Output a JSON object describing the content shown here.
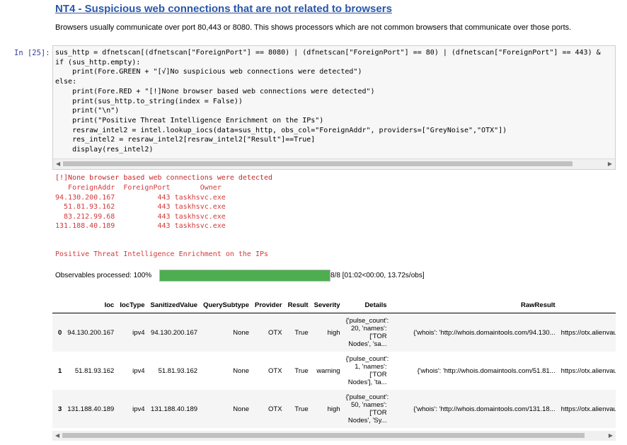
{
  "markdown": {
    "title": "NT4 - Suspicious web connections that are not related to browsers",
    "description": "Browsers usually communicate over port 80,443 or 8080. This shows processors which are not common browsers that communicate over those ports."
  },
  "cell": {
    "prompt": "In [25]:",
    "code": "sus_http = dfnetscan[(dfnetscan[\"ForeignPort\"] == 8080) | (dfnetscan[\"ForeignPort\"] == 80) | (dfnetscan[\"ForeignPort\"] == 443) &\nif (sus_http.empty):\n    print(Fore.GREEN + \"[√]No suspicious web connections were detected\")\nelse:\n    print(Fore.RED + \"[!]None browser based web connections were detected\")\n    print(sus_http.to_string(index = False))\n    print(\"\\n\")\n    print(\"Positive Threat Intelligence Enrichment on the IPs\")\n    resraw_intel2 = intel.lookup_iocs(data=sus_http, obs_col=\"ForeignAddr\", providers=[\"GreyNoise\",\"OTX\"])\n    res_intel2 = resraw_intel2[resraw_intel2[\"Result\"]==True]\n    display(res_intel2)"
  },
  "output": {
    "warning": "[!]None browser based web connections were detected",
    "text_table": "   ForeignAddr  ForeignPort       Owner\n94.130.200.167          443 taskhsvc.exe\n  51.81.93.162          443 taskhsvc.exe\n  83.212.99.68          443 taskhsvc.exe\n131.188.40.189          443 taskhsvc.exe",
    "enrichment_heading": "Positive Threat Intelligence Enrichment on the IPs",
    "progress_label": "Observables processed: 100%",
    "progress_fraction": 1.0,
    "progress_stat": "8/8 [01:02<00:00, 13.72s/obs]"
  },
  "table": {
    "headers": [
      "",
      "Ioc",
      "IocType",
      "SanitizedValue",
      "QuerySubtype",
      "Provider",
      "Result",
      "Severity",
      "Details",
      "RawResult",
      ""
    ],
    "rows": [
      {
        "index": "0",
        "ioc": "94.130.200.167",
        "ioc_type": "ipv4",
        "sanitized": "94.130.200.167",
        "subtype": "None",
        "provider": "OTX",
        "result": "True",
        "severity": "high",
        "details": "{'pulse_count': 20, 'names': ['TOR Nodes', 'sa...",
        "raw": "{'whois': 'http://whois.domaintools.com/94.130...",
        "ref": "https://otx.alienvault.com/ap"
      },
      {
        "index": "1",
        "ioc": "51.81.93.162",
        "ioc_type": "ipv4",
        "sanitized": "51.81.93.162",
        "subtype": "None",
        "provider": "OTX",
        "result": "True",
        "severity": "warning",
        "details": "{'pulse_count': 1, 'names': ['TOR Nodes'], 'ta...",
        "raw": "{'whois': 'http://whois.domaintools.com/51.81...",
        "ref": "https://otx.alienvault.com/ap"
      },
      {
        "index": "3",
        "ioc": "131.188.40.189",
        "ioc_type": "ipv4",
        "sanitized": "131.188.40.189",
        "subtype": "None",
        "provider": "OTX",
        "result": "True",
        "severity": "high",
        "details": "{'pulse_count': 50, 'names': ['TOR Nodes', 'Sy...",
        "raw": "{'whois': 'http://whois.domaintools.com/131.18...",
        "ref": "https://otx.alienvault.com/ap"
      }
    ]
  },
  "colors": {
    "title": "#2a56a8",
    "prompt": "#303f9f",
    "output_red": "#c62828",
    "progress_fill": "#4cae4f"
  }
}
